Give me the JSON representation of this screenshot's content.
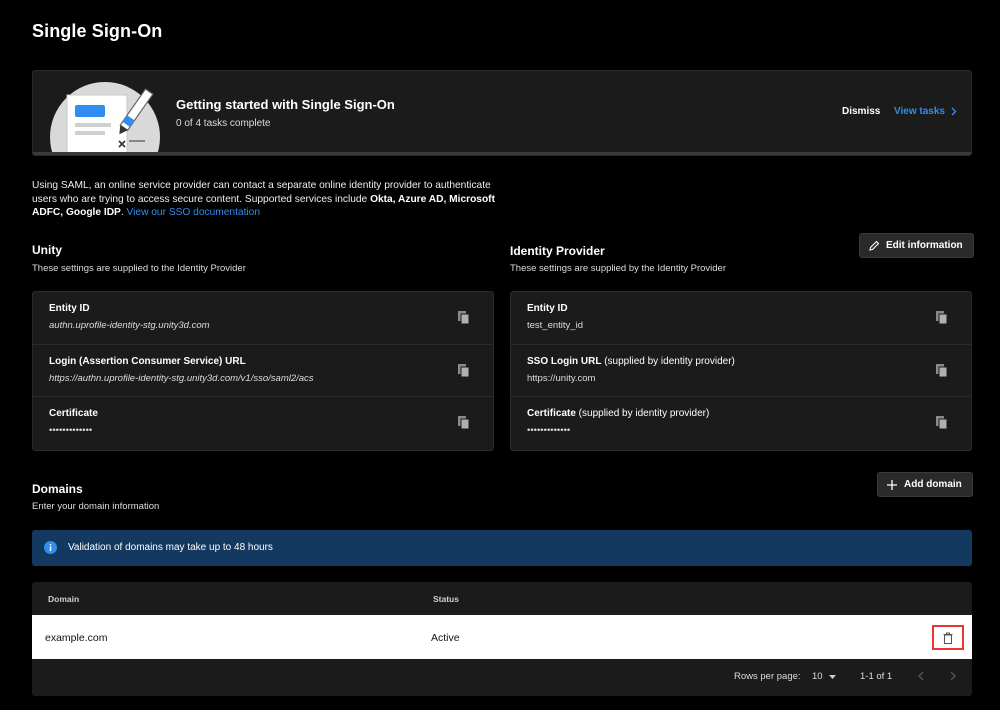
{
  "page": {
    "title": "Single Sign-On"
  },
  "banner": {
    "title": "Getting started with Single Sign-On",
    "progress": "0 of 4 tasks complete",
    "dismiss_label": "Dismiss",
    "view_tasks_label": "View tasks"
  },
  "intro": {
    "text_1": "Using SAML, an online service provider can contact a separate online identity provider to authenticate users who are trying to access secure content. Supported services include ",
    "services": "Okta, Azure AD, Microsoft ADFC, Google IDP",
    "text_2": ". ",
    "link": "View our SSO documentation"
  },
  "unity": {
    "title": "Unity",
    "subtitle": "These settings are supplied to the Identity Provider",
    "rows": [
      {
        "label": "Entity ID",
        "value": "authn.uprofile-identity-stg.unity3d.com"
      },
      {
        "label": "Login (Assertion Consumer Service) URL",
        "value": "https://authn.uprofile-identity-stg.unity3d.com/v1/sso/saml2/acs"
      },
      {
        "label": "Certificate",
        "value": "•••••••••••••"
      }
    ]
  },
  "idp": {
    "title": "Identity Provider",
    "subtitle": "These settings are supplied by the Identity Provider",
    "edit_label": "Edit information",
    "rows": [
      {
        "label": "Entity ID",
        "extra": "",
        "value": "test_entity_id"
      },
      {
        "label": "SSO Login URL",
        "extra": " (supplied by identity provider)",
        "value": "https://unity.com"
      },
      {
        "label": "Certificate",
        "extra": " (supplied by identity provider)",
        "value": "•••••••••••••"
      }
    ]
  },
  "domains": {
    "title": "Domains",
    "subtitle": "Enter your domain information",
    "add_label": "Add domain",
    "alert": "Validation of domains may take up to 48 hours",
    "columns": [
      "Domain",
      "Status"
    ],
    "rows": [
      {
        "domain": "example.com",
        "status": "Active"
      }
    ],
    "rows_per_page_label": "Rows per page:",
    "rows_per_page_value": "10",
    "page_range": "1-1 of 1"
  },
  "colors": {
    "accent": "#2f8ef0",
    "alert_bg": "#133960",
    "card_bg": "#1b1b1b"
  },
  "icons": [
    "document-illustration-icon",
    "chevron-right-icon",
    "pencil-icon",
    "copy-icon",
    "plus-icon",
    "info-icon",
    "trash-icon",
    "caret-down-icon",
    "chevron-left-icon"
  ]
}
